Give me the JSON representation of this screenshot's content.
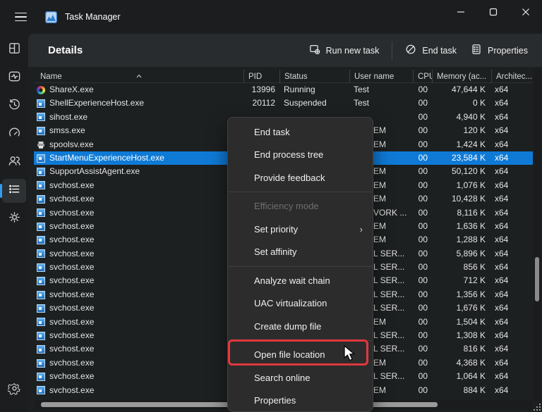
{
  "window": {
    "title": "Task Manager"
  },
  "titlebar": {
    "controls": [
      "minimize",
      "maximize",
      "close"
    ]
  },
  "colors": {
    "accent_blue": "#2f9df3",
    "selection_blue": "#0f7ad6",
    "highlight_red": "#e0383e"
  },
  "sidebar": {
    "items": [
      {
        "icon": "processes-icon",
        "selected": false
      },
      {
        "icon": "performance-icon",
        "selected": false
      },
      {
        "icon": "app-history-icon",
        "selected": false
      },
      {
        "icon": "startup-apps-icon",
        "selected": false
      },
      {
        "icon": "users-icon",
        "selected": false
      },
      {
        "icon": "details-icon",
        "selected": true
      },
      {
        "icon": "services-icon",
        "selected": false
      }
    ],
    "bottom_item": {
      "icon": "settings-icon"
    }
  },
  "toolbar": {
    "title": "Details",
    "buttons": [
      {
        "icon": "run-new-task-icon",
        "label": "Run new task"
      },
      {
        "icon": "end-task-icon",
        "label": "End task"
      },
      {
        "icon": "properties-icon",
        "label": "Properties"
      }
    ]
  },
  "table": {
    "columns": [
      {
        "label": "Name",
        "sorted": "ascending"
      },
      {
        "label": "PID"
      },
      {
        "label": "Status"
      },
      {
        "label": "User name"
      },
      {
        "label": "CPU"
      },
      {
        "label": "Memory (ac..."
      },
      {
        "label": "Architec..."
      }
    ],
    "rows": [
      {
        "icon": "sharex",
        "name": "ShareX.exe",
        "pid": "13996",
        "status": "Running",
        "user": "Test",
        "tail": false,
        "cpu": "00",
        "memory": "47,644 K",
        "arch": "x64",
        "selected": false
      },
      {
        "icon": "window",
        "name": "ShellExperienceHost.exe",
        "pid": "20112",
        "status": "Suspended",
        "user": "Test",
        "tail": false,
        "cpu": "00",
        "memory": "0 K",
        "arch": "x64",
        "selected": false
      },
      {
        "icon": "window",
        "name": "sihost.exe",
        "pid": "",
        "status": "",
        "user": "",
        "tail": false,
        "cpu": "00",
        "memory": "4,940 K",
        "arch": "x64",
        "selected": false
      },
      {
        "icon": "window",
        "name": "smss.exe",
        "pid": "",
        "status": "",
        "user": "EM",
        "tail": true,
        "cpu": "00",
        "memory": "120 K",
        "arch": "x64",
        "selected": false
      },
      {
        "icon": "printer",
        "name": "spoolsv.exe",
        "pid": "",
        "status": "",
        "user": "EM",
        "tail": true,
        "cpu": "00",
        "memory": "1,424 K",
        "arch": "x64",
        "selected": false
      },
      {
        "icon": "window",
        "name": "StartMenuExperienceHost.exe",
        "pid": "",
        "status": "",
        "user": "",
        "tail": false,
        "cpu": "00",
        "memory": "23,584 K",
        "arch": "x64",
        "selected": true
      },
      {
        "icon": "window",
        "name": "SupportAssistAgent.exe",
        "pid": "",
        "status": "",
        "user": "EM",
        "tail": true,
        "cpu": "00",
        "memory": "50,120 K",
        "arch": "x64",
        "selected": false
      },
      {
        "icon": "window",
        "name": "svchost.exe",
        "pid": "",
        "status": "",
        "user": "EM",
        "tail": true,
        "cpu": "00",
        "memory": "1,076 K",
        "arch": "x64",
        "selected": false
      },
      {
        "icon": "window",
        "name": "svchost.exe",
        "pid": "",
        "status": "",
        "user": "EM",
        "tail": true,
        "cpu": "00",
        "memory": "10,428 K",
        "arch": "x64",
        "selected": false
      },
      {
        "icon": "window",
        "name": "svchost.exe",
        "pid": "",
        "status": "",
        "user": "VORK ...",
        "tail": true,
        "cpu": "00",
        "memory": "8,116 K",
        "arch": "x64",
        "selected": false
      },
      {
        "icon": "window",
        "name": "svchost.exe",
        "pid": "",
        "status": "",
        "user": "EM",
        "tail": true,
        "cpu": "00",
        "memory": "1,636 K",
        "arch": "x64",
        "selected": false
      },
      {
        "icon": "window",
        "name": "svchost.exe",
        "pid": "",
        "status": "",
        "user": "EM",
        "tail": true,
        "cpu": "00",
        "memory": "1,288 K",
        "arch": "x64",
        "selected": false
      },
      {
        "icon": "window",
        "name": "svchost.exe",
        "pid": "",
        "status": "",
        "user": "L SER...",
        "tail": true,
        "cpu": "00",
        "memory": "5,896 K",
        "arch": "x64",
        "selected": false
      },
      {
        "icon": "window",
        "name": "svchost.exe",
        "pid": "",
        "status": "",
        "user": "L SER...",
        "tail": true,
        "cpu": "00",
        "memory": "856 K",
        "arch": "x64",
        "selected": false
      },
      {
        "icon": "window",
        "name": "svchost.exe",
        "pid": "",
        "status": "",
        "user": "L SER...",
        "tail": true,
        "cpu": "00",
        "memory": "712 K",
        "arch": "x64",
        "selected": false
      },
      {
        "icon": "window",
        "name": "svchost.exe",
        "pid": "",
        "status": "",
        "user": "L SER...",
        "tail": true,
        "cpu": "00",
        "memory": "1,356 K",
        "arch": "x64",
        "selected": false
      },
      {
        "icon": "window",
        "name": "svchost.exe",
        "pid": "",
        "status": "",
        "user": "L SER...",
        "tail": true,
        "cpu": "00",
        "memory": "1,676 K",
        "arch": "x64",
        "selected": false
      },
      {
        "icon": "window",
        "name": "svchost.exe",
        "pid": "",
        "status": "",
        "user": "EM",
        "tail": true,
        "cpu": "00",
        "memory": "1,504 K",
        "arch": "x64",
        "selected": false
      },
      {
        "icon": "window",
        "name": "svchost.exe",
        "pid": "",
        "status": "",
        "user": "L SER...",
        "tail": true,
        "cpu": "00",
        "memory": "1,308 K",
        "arch": "x64",
        "selected": false
      },
      {
        "icon": "window",
        "name": "svchost.exe",
        "pid": "",
        "status": "",
        "user": "L SER...",
        "tail": true,
        "cpu": "00",
        "memory": "816 K",
        "arch": "x64",
        "selected": false
      },
      {
        "icon": "window",
        "name": "svchost.exe",
        "pid": "",
        "status": "",
        "user": "EM",
        "tail": true,
        "cpu": "00",
        "memory": "4,368 K",
        "arch": "x64",
        "selected": false
      },
      {
        "icon": "window",
        "name": "svchost.exe",
        "pid": "",
        "status": "",
        "user": "L SER...",
        "tail": true,
        "cpu": "00",
        "memory": "1,064 K",
        "arch": "x64",
        "selected": false
      },
      {
        "icon": "window",
        "name": "svchost.exe",
        "pid": "",
        "status": "",
        "user": "EM",
        "tail": true,
        "cpu": "00",
        "memory": "884 K",
        "arch": "x64",
        "selected": false
      }
    ]
  },
  "context_menu": {
    "items": [
      {
        "label": "End task"
      },
      {
        "label": "End process tree"
      },
      {
        "label": "Provide feedback"
      },
      {
        "type": "separator"
      },
      {
        "label": "Efficiency mode",
        "disabled": true
      },
      {
        "label": "Set priority",
        "submenu": true
      },
      {
        "label": "Set affinity"
      },
      {
        "type": "separator"
      },
      {
        "label": "Analyze wait chain"
      },
      {
        "label": "UAC virtualization"
      },
      {
        "label": "Create dump file"
      },
      {
        "type": "separator"
      },
      {
        "label": "Open file location",
        "highlighted": true
      },
      {
        "label": "Search online"
      },
      {
        "label": "Properties"
      }
    ]
  }
}
